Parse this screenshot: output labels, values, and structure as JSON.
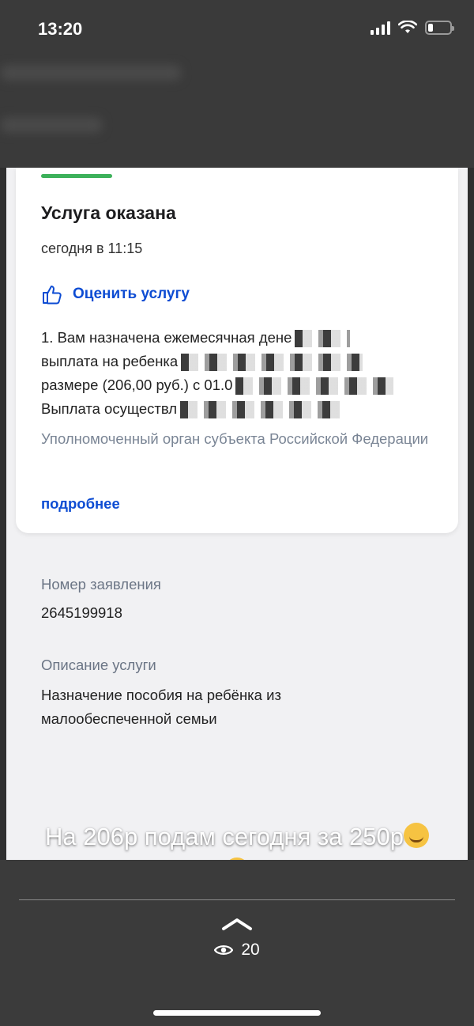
{
  "status_bar": {
    "time": "13:20"
  },
  "card": {
    "title": "Услуга оказана",
    "time": "сегодня в 11:15",
    "rate_label": "Оценить услугу",
    "message_lines": [
      "1. Вам назначена ежемесячная дене",
      "выплата на ребенка",
      "размере (206,00 руб.) с 01.0",
      "Выплата осуществл"
    ],
    "authority": "Уполномоченный орган субъекта Российской Федерации",
    "more_link": "подробнее"
  },
  "details": {
    "application_label": "Номер заявления",
    "application_number": "2645199918",
    "description_label": "Описание услуги",
    "description_value": "Назначение пособия на ребёнка из малообеспеченной семьи"
  },
  "story": {
    "caption": "На 206р подам сегодня за 250р",
    "views": "20"
  },
  "colors": {
    "accent": "#0d4cd3",
    "success": "#3cb15a",
    "muted": "#7a8595"
  }
}
